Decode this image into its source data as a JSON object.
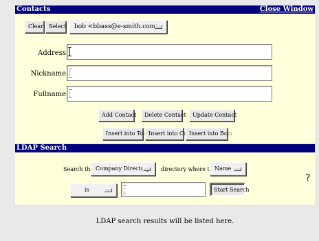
{
  "contacts": {
    "title": "Contacts",
    "close_label": "Close Window",
    "clear_label": "Clear",
    "select_label": "Select",
    "contact_dropdown_value": "bob <bbass@e-smith.com>",
    "address_label": "Address",
    "nickname_label": "Nickname",
    "fullname_label": "Fullname",
    "address_value": "",
    "nickname_value": "",
    "fullname_value": "",
    "add_contact_label": "Add Contact",
    "delete_contact_label": "Delete Contact",
    "update_contact_label": "Update Contact",
    "insert_to_label": "Insert into To:",
    "insert_cc_label": "Insert into Cc:",
    "insert_bcc_label": "Insert into Bcc:"
  },
  "ldap": {
    "title": "LDAP Search",
    "search_the_text": "Search the",
    "directory_value": "Company Directory",
    "where_text": "directory where the",
    "attribute_value": "Name",
    "operator_value": "is",
    "search_value": "",
    "start_search_label": "Start Search",
    "help_glyph": "?",
    "results_text": "LDAP search results will be listed here."
  },
  "colors": {
    "title_bar": "#00007c",
    "panel": "#ffffdb",
    "background": "#e9e9e9"
  }
}
